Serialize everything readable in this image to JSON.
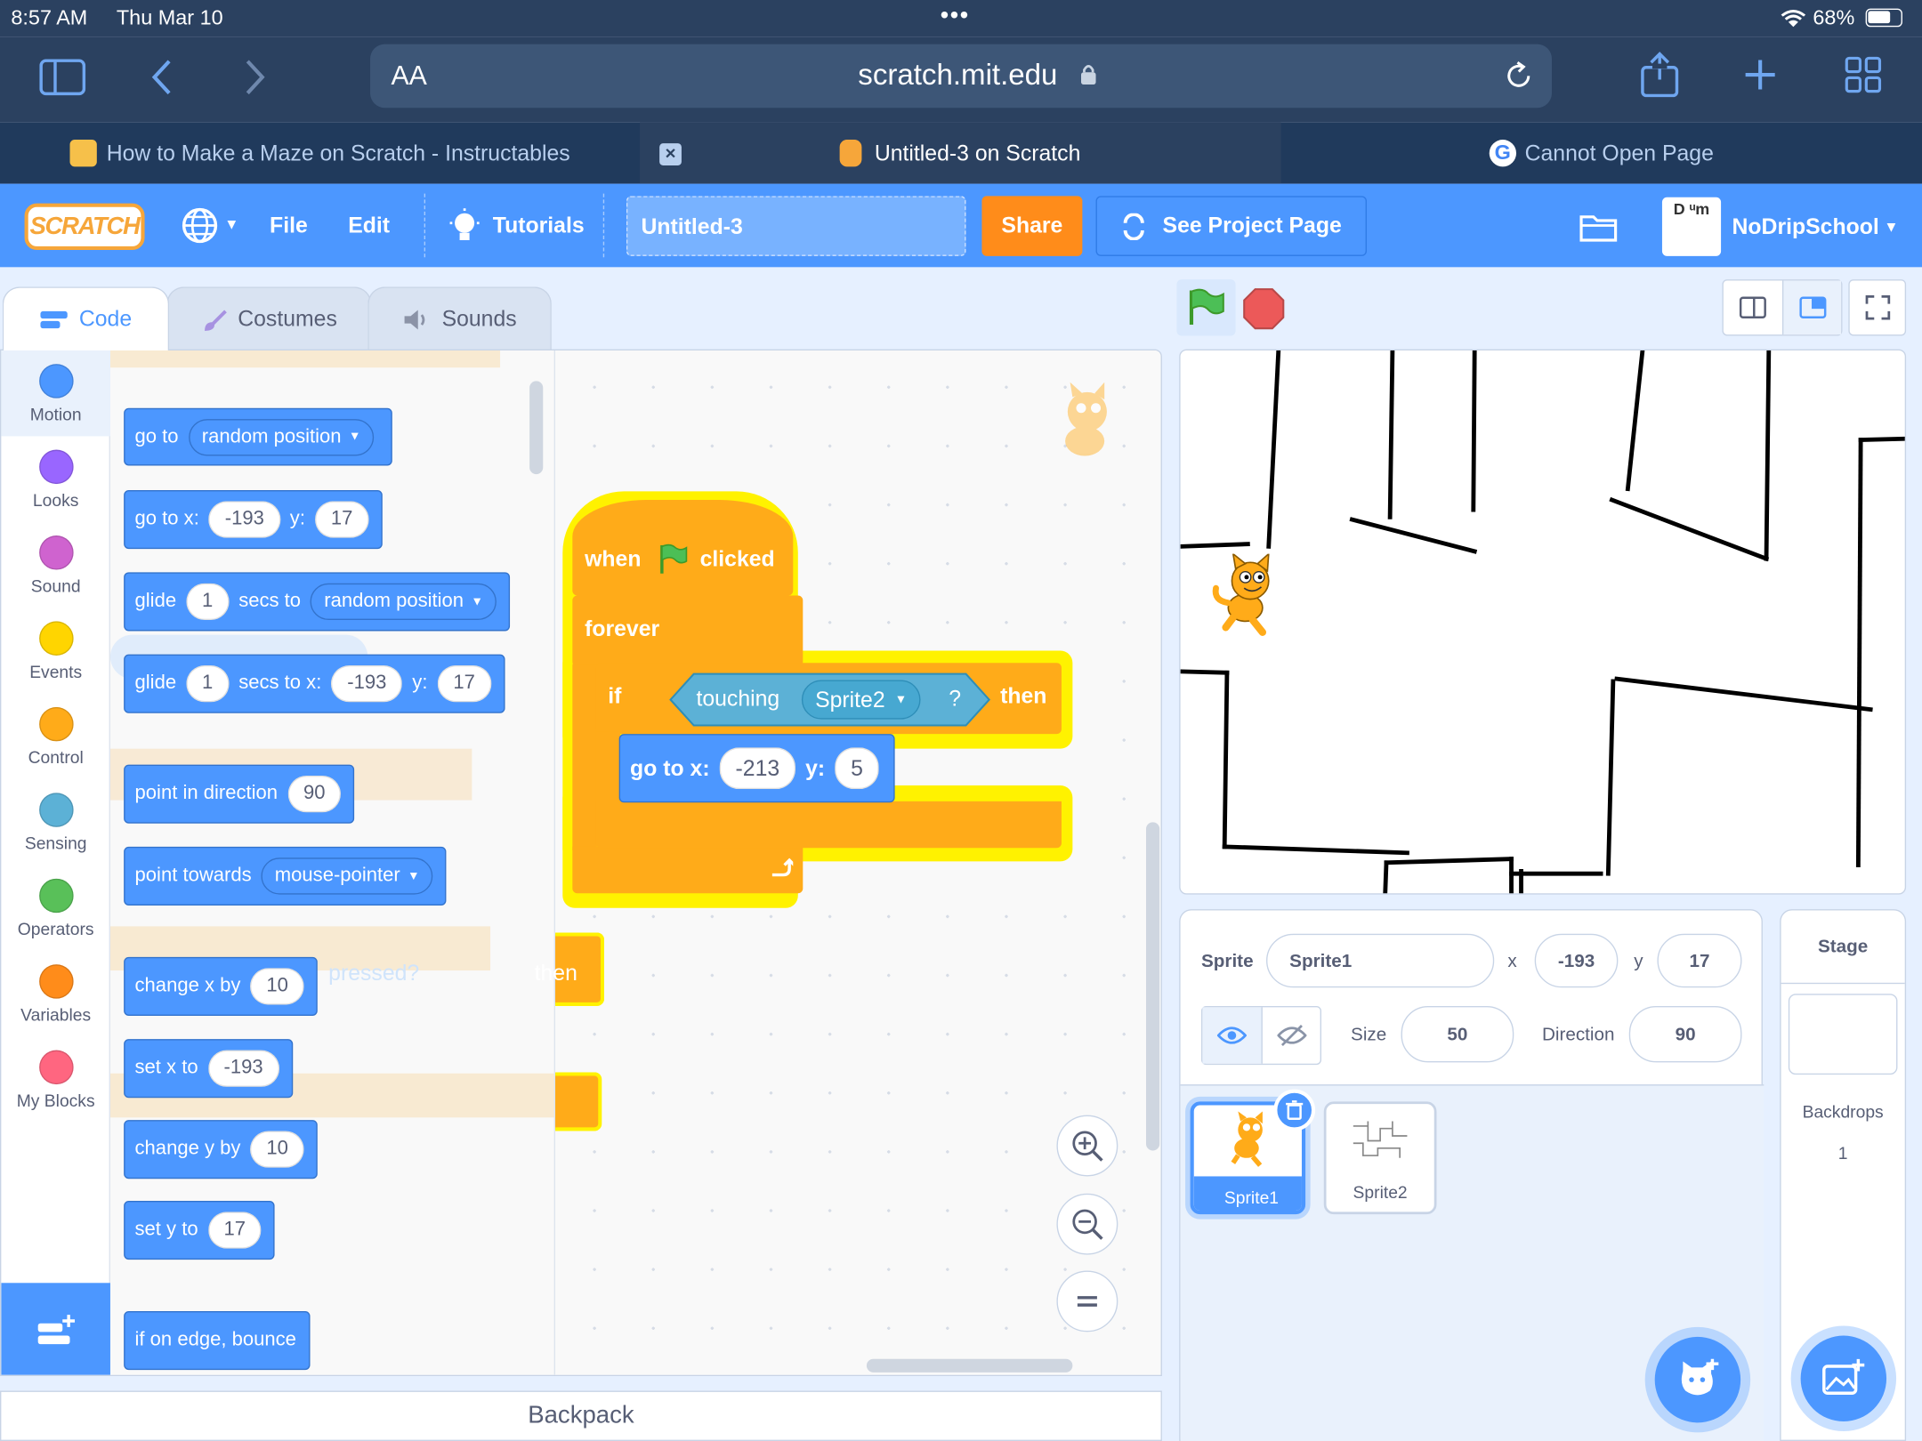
{
  "status": {
    "time": "8:57 AM",
    "date": "Thu Mar 10",
    "battery": "68%"
  },
  "safari": {
    "text_size": "AA",
    "url": "scratch.mit.edu"
  },
  "tabs": [
    {
      "label": "How to Make a Maze on Scratch - Instructables"
    },
    {
      "label": "Untitled-3 on Scratch"
    },
    {
      "label": "Cannot Open Page"
    }
  ],
  "menubar": {
    "logo": "SCRATCH",
    "file": "File",
    "edit": "Edit",
    "tutorials": "Tutorials",
    "project_title": "Untitled-3",
    "share": "Share",
    "see_project_page": "See Project Page",
    "username": "NoDripSchool"
  },
  "editor_tabs": {
    "code": "Code",
    "costumes": "Costumes",
    "sounds": "Sounds"
  },
  "categories": [
    {
      "label": "Motion",
      "color": "#4c97ff"
    },
    {
      "label": "Looks",
      "color": "#9966ff"
    },
    {
      "label": "Sound",
      "color": "#cf63cf"
    },
    {
      "label": "Events",
      "color": "#ffd500"
    },
    {
      "label": "Control",
      "color": "#ffab19"
    },
    {
      "label": "Sensing",
      "color": "#5cb1d6"
    },
    {
      "label": "Operators",
      "color": "#59c059"
    },
    {
      "label": "Variables",
      "color": "#ff8c1a"
    },
    {
      "label": "My Blocks",
      "color": "#ff6680"
    }
  ],
  "palette": {
    "goto_label": "go to",
    "goto_target": "random position",
    "gotoxy_label": "go to x:",
    "gotoxy_x": "-193",
    "y_label": "y:",
    "gotoxy_y": "17",
    "glide_label": "glide",
    "glide_secs": "1",
    "secs_to": "secs to",
    "glide_target": "random position",
    "glide2_secs": "1",
    "secs_to_x": "secs to x:",
    "glide2_x": "-193",
    "glide2_y": "17",
    "point_dir_label": "point in direction",
    "point_dir_val": "90",
    "point_towards_label": "point towards",
    "point_towards_val": "mouse-pointer",
    "change_x_label": "change x by",
    "change_x_val": "10",
    "set_x_label": "set x to",
    "set_x_val": "-193",
    "change_y_label": "change y by",
    "change_y_val": "10",
    "set_y_label": "set y to",
    "set_y_val": "17",
    "bounce_label": "if on edge, bounce"
  },
  "script": {
    "when": "when",
    "clicked": "clicked",
    "forever": "forever",
    "if": "if",
    "touching": "touching",
    "touching_target": "Sprite2",
    "question": "?",
    "then": "then",
    "goto_label": "go to x:",
    "goto_x": "-213",
    "y_label": "y:",
    "goto_y": "5"
  },
  "ghost": {
    "arrow_pressed": "pressed?",
    "then": "then"
  },
  "backpack": "Backpack",
  "sprite_info": {
    "sprite_label": "Sprite",
    "sprite_name": "Sprite1",
    "x_label": "x",
    "x": "-193",
    "y_label": "y",
    "y": "17",
    "size_label": "Size",
    "size": "50",
    "direction_label": "Direction",
    "direction": "90"
  },
  "sprites": [
    {
      "name": "Sprite1"
    },
    {
      "name": "Sprite2"
    }
  ],
  "stage_panel": {
    "title": "Stage",
    "backdrops_label": "Backdrops",
    "backdrops_count": "1"
  }
}
